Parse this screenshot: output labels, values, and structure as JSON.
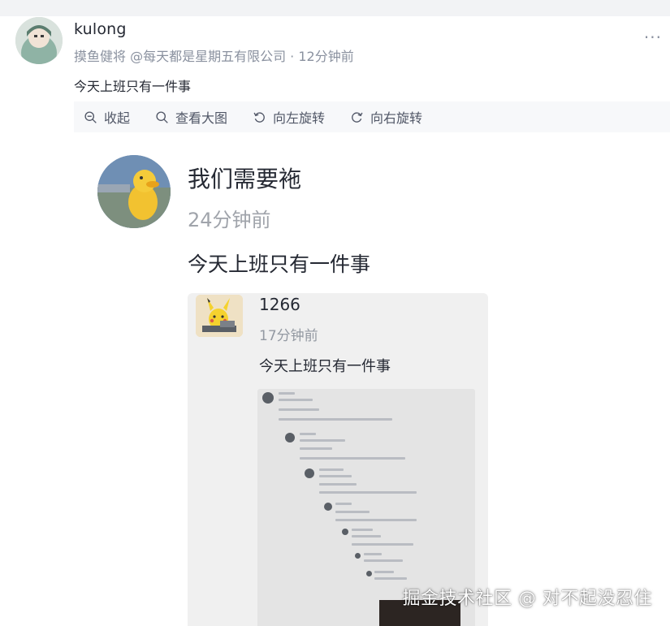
{
  "post": {
    "username": "kulong",
    "meta": "摸鱼健将 @每天都是星期五有限公司 · 12分钟前",
    "content": "今天上班只有一件事",
    "more_icon": "more-horizontal-icon"
  },
  "toolbar": {
    "items": [
      {
        "label": "收起",
        "icon": "zoom-out-icon"
      },
      {
        "label": "查看大图",
        "icon": "search-icon"
      },
      {
        "label": "向左旋转",
        "icon": "rotate-left-icon"
      },
      {
        "label": "向右旋转",
        "icon": "rotate-right-icon"
      }
    ]
  },
  "image": {
    "level1": {
      "name": "我们需要袘",
      "time": "24分钟前",
      "content": "今天上班只有一件事"
    },
    "level2": {
      "name": "1266",
      "time": "17分钟前",
      "content": "今天上班只有一件事"
    },
    "watermark": "掘金技术社区 @ 对不起没忍住"
  },
  "colors": {
    "accent_text": "#252933",
    "muted_text": "#8a919f",
    "toolbar_bg": "#f7f8fa",
    "page_bg": "#ffffff"
  }
}
